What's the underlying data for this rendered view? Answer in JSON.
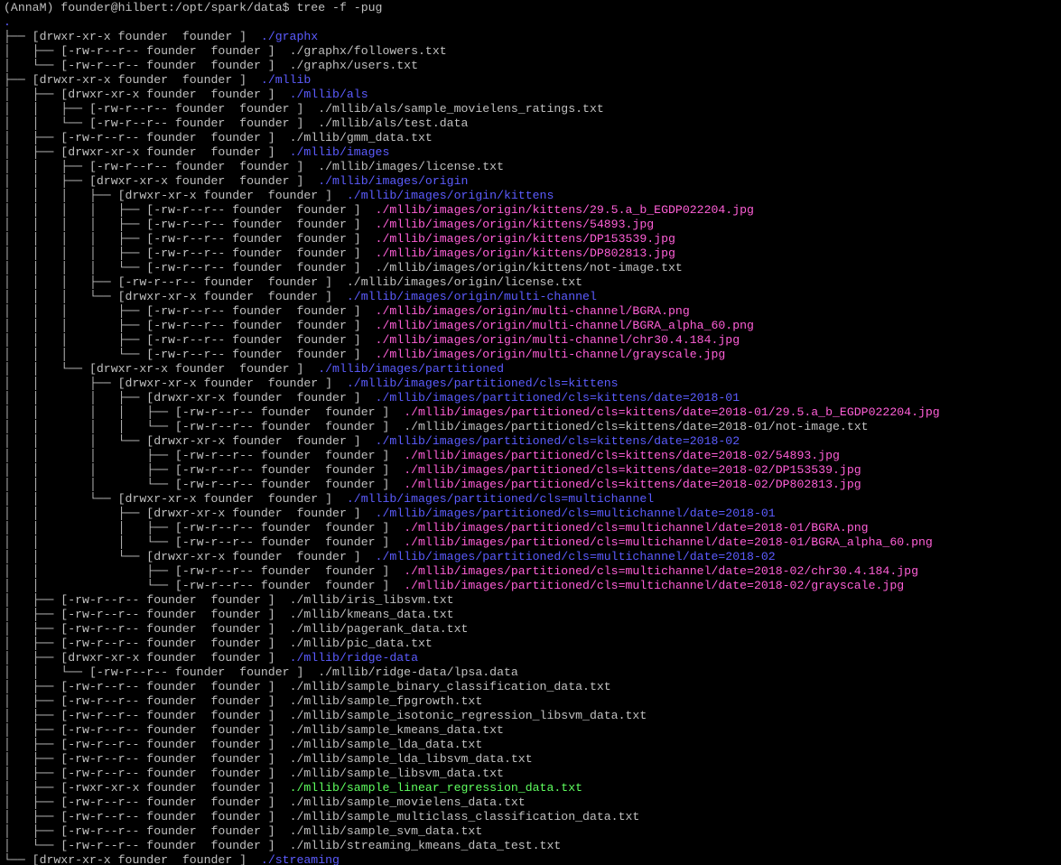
{
  "terminal": {
    "prompt": "(AnnaM) founder@hilbert:/opt/spark/data$ tree -f -pug",
    "colors": {
      "default": "#c0c0c0",
      "dir": "#5c5cff",
      "img": "#ff5fd7",
      "exec": "#5fff5f",
      "background": "#000000"
    },
    "lines": [
      {
        "prefix": ".",
        "path": "",
        "kind": "dir"
      },
      {
        "prefix": "├── [drwxr-xr-x founder  founder ]  ",
        "path": "./graphx",
        "kind": "dir"
      },
      {
        "prefix": "│   ├── [-rw-r--r-- founder  founder ]  ",
        "path": "./graphx/followers.txt",
        "kind": "default"
      },
      {
        "prefix": "│   └── [-rw-r--r-- founder  founder ]  ",
        "path": "./graphx/users.txt",
        "kind": "default"
      },
      {
        "prefix": "├── [drwxr-xr-x founder  founder ]  ",
        "path": "./mllib",
        "kind": "dir"
      },
      {
        "prefix": "│   ├── [drwxr-xr-x founder  founder ]  ",
        "path": "./mllib/als",
        "kind": "dir"
      },
      {
        "prefix": "│   │   ├── [-rw-r--r-- founder  founder ]  ",
        "path": "./mllib/als/sample_movielens_ratings.txt",
        "kind": "default"
      },
      {
        "prefix": "│   │   └── [-rw-r--r-- founder  founder ]  ",
        "path": "./mllib/als/test.data",
        "kind": "default"
      },
      {
        "prefix": "│   ├── [-rw-r--r-- founder  founder ]  ",
        "path": "./mllib/gmm_data.txt",
        "kind": "default"
      },
      {
        "prefix": "│   ├── [drwxr-xr-x founder  founder ]  ",
        "path": "./mllib/images",
        "kind": "dir"
      },
      {
        "prefix": "│   │   ├── [-rw-r--r-- founder  founder ]  ",
        "path": "./mllib/images/license.txt",
        "kind": "default"
      },
      {
        "prefix": "│   │   ├── [drwxr-xr-x founder  founder ]  ",
        "path": "./mllib/images/origin",
        "kind": "dir"
      },
      {
        "prefix": "│   │   │   ├── [drwxr-xr-x founder  founder ]  ",
        "path": "./mllib/images/origin/kittens",
        "kind": "dir"
      },
      {
        "prefix": "│   │   │   │   ├── [-rw-r--r-- founder  founder ]  ",
        "path": "./mllib/images/origin/kittens/29.5.a_b_EGDP022204.jpg",
        "kind": "img"
      },
      {
        "prefix": "│   │   │   │   ├── [-rw-r--r-- founder  founder ]  ",
        "path": "./mllib/images/origin/kittens/54893.jpg",
        "kind": "img"
      },
      {
        "prefix": "│   │   │   │   ├── [-rw-r--r-- founder  founder ]  ",
        "path": "./mllib/images/origin/kittens/DP153539.jpg",
        "kind": "img"
      },
      {
        "prefix": "│   │   │   │   ├── [-rw-r--r-- founder  founder ]  ",
        "path": "./mllib/images/origin/kittens/DP802813.jpg",
        "kind": "img"
      },
      {
        "prefix": "│   │   │   │   └── [-rw-r--r-- founder  founder ]  ",
        "path": "./mllib/images/origin/kittens/not-image.txt",
        "kind": "default"
      },
      {
        "prefix": "│   │   │   ├── [-rw-r--r-- founder  founder ]  ",
        "path": "./mllib/images/origin/license.txt",
        "kind": "default"
      },
      {
        "prefix": "│   │   │   └── [drwxr-xr-x founder  founder ]  ",
        "path": "./mllib/images/origin/multi-channel",
        "kind": "dir"
      },
      {
        "prefix": "│   │   │       ├── [-rw-r--r-- founder  founder ]  ",
        "path": "./mllib/images/origin/multi-channel/BGRA.png",
        "kind": "img"
      },
      {
        "prefix": "│   │   │       ├── [-rw-r--r-- founder  founder ]  ",
        "path": "./mllib/images/origin/multi-channel/BGRA_alpha_60.png",
        "kind": "img"
      },
      {
        "prefix": "│   │   │       ├── [-rw-r--r-- founder  founder ]  ",
        "path": "./mllib/images/origin/multi-channel/chr30.4.184.jpg",
        "kind": "img"
      },
      {
        "prefix": "│   │   │       └── [-rw-r--r-- founder  founder ]  ",
        "path": "./mllib/images/origin/multi-channel/grayscale.jpg",
        "kind": "img"
      },
      {
        "prefix": "│   │   └── [drwxr-xr-x founder  founder ]  ",
        "path": "./mllib/images/partitioned",
        "kind": "dir"
      },
      {
        "prefix": "│   │       ├── [drwxr-xr-x founder  founder ]  ",
        "path": "./mllib/images/partitioned/cls=kittens",
        "kind": "dir"
      },
      {
        "prefix": "│   │       │   ├── [drwxr-xr-x founder  founder ]  ",
        "path": "./mllib/images/partitioned/cls=kittens/date=2018-01",
        "kind": "dir"
      },
      {
        "prefix": "│   │       │   │   ├── [-rw-r--r-- founder  founder ]  ",
        "path": "./mllib/images/partitioned/cls=kittens/date=2018-01/29.5.a_b_EGDP022204.jpg",
        "kind": "img"
      },
      {
        "prefix": "│   │       │   │   └── [-rw-r--r-- founder  founder ]  ",
        "path": "./mllib/images/partitioned/cls=kittens/date=2018-01/not-image.txt",
        "kind": "default"
      },
      {
        "prefix": "│   │       │   └── [drwxr-xr-x founder  founder ]  ",
        "path": "./mllib/images/partitioned/cls=kittens/date=2018-02",
        "kind": "dir"
      },
      {
        "prefix": "│   │       │       ├── [-rw-r--r-- founder  founder ]  ",
        "path": "./mllib/images/partitioned/cls=kittens/date=2018-02/54893.jpg",
        "kind": "img"
      },
      {
        "prefix": "│   │       │       ├── [-rw-r--r-- founder  founder ]  ",
        "path": "./mllib/images/partitioned/cls=kittens/date=2018-02/DP153539.jpg",
        "kind": "img"
      },
      {
        "prefix": "│   │       │       └── [-rw-r--r-- founder  founder ]  ",
        "path": "./mllib/images/partitioned/cls=kittens/date=2018-02/DP802813.jpg",
        "kind": "img"
      },
      {
        "prefix": "│   │       └── [drwxr-xr-x founder  founder ]  ",
        "path": "./mllib/images/partitioned/cls=multichannel",
        "kind": "dir"
      },
      {
        "prefix": "│   │           ├── [drwxr-xr-x founder  founder ]  ",
        "path": "./mllib/images/partitioned/cls=multichannel/date=2018-01",
        "kind": "dir"
      },
      {
        "prefix": "│   │           │   ├── [-rw-r--r-- founder  founder ]  ",
        "path": "./mllib/images/partitioned/cls=multichannel/date=2018-01/BGRA.png",
        "kind": "img"
      },
      {
        "prefix": "│   │           │   └── [-rw-r--r-- founder  founder ]  ",
        "path": "./mllib/images/partitioned/cls=multichannel/date=2018-01/BGRA_alpha_60.png",
        "kind": "img"
      },
      {
        "prefix": "│   │           └── [drwxr-xr-x founder  founder ]  ",
        "path": "./mllib/images/partitioned/cls=multichannel/date=2018-02",
        "kind": "dir"
      },
      {
        "prefix": "│   │               ├── [-rw-r--r-- founder  founder ]  ",
        "path": "./mllib/images/partitioned/cls=multichannel/date=2018-02/chr30.4.184.jpg",
        "kind": "img"
      },
      {
        "prefix": "│   │               └── [-rw-r--r-- founder  founder ]  ",
        "path": "./mllib/images/partitioned/cls=multichannel/date=2018-02/grayscale.jpg",
        "kind": "img"
      },
      {
        "prefix": "│   ├── [-rw-r--r-- founder  founder ]  ",
        "path": "./mllib/iris_libsvm.txt",
        "kind": "default"
      },
      {
        "prefix": "│   ├── [-rw-r--r-- founder  founder ]  ",
        "path": "./mllib/kmeans_data.txt",
        "kind": "default"
      },
      {
        "prefix": "│   ├── [-rw-r--r-- founder  founder ]  ",
        "path": "./mllib/pagerank_data.txt",
        "kind": "default"
      },
      {
        "prefix": "│   ├── [-rw-r--r-- founder  founder ]  ",
        "path": "./mllib/pic_data.txt",
        "kind": "default"
      },
      {
        "prefix": "│   ├── [drwxr-xr-x founder  founder ]  ",
        "path": "./mllib/ridge-data",
        "kind": "dir"
      },
      {
        "prefix": "│   │   └── [-rw-r--r-- founder  founder ]  ",
        "path": "./mllib/ridge-data/lpsa.data",
        "kind": "default"
      },
      {
        "prefix": "│   ├── [-rw-r--r-- founder  founder ]  ",
        "path": "./mllib/sample_binary_classification_data.txt",
        "kind": "default"
      },
      {
        "prefix": "│   ├── [-rw-r--r-- founder  founder ]  ",
        "path": "./mllib/sample_fpgrowth.txt",
        "kind": "default"
      },
      {
        "prefix": "│   ├── [-rw-r--r-- founder  founder ]  ",
        "path": "./mllib/sample_isotonic_regression_libsvm_data.txt",
        "kind": "default"
      },
      {
        "prefix": "│   ├── [-rw-r--r-- founder  founder ]  ",
        "path": "./mllib/sample_kmeans_data.txt",
        "kind": "default"
      },
      {
        "prefix": "│   ├── [-rw-r--r-- founder  founder ]  ",
        "path": "./mllib/sample_lda_data.txt",
        "kind": "default"
      },
      {
        "prefix": "│   ├── [-rw-r--r-- founder  founder ]  ",
        "path": "./mllib/sample_lda_libsvm_data.txt",
        "kind": "default"
      },
      {
        "prefix": "│   ├── [-rw-r--r-- founder  founder ]  ",
        "path": "./mllib/sample_libsvm_data.txt",
        "kind": "default"
      },
      {
        "prefix": "│   ├── [-rwxr-xr-x founder  founder ]  ",
        "path": "./mllib/sample_linear_regression_data.txt",
        "kind": "exec"
      },
      {
        "prefix": "│   ├── [-rw-r--r-- founder  founder ]  ",
        "path": "./mllib/sample_movielens_data.txt",
        "kind": "default"
      },
      {
        "prefix": "│   ├── [-rw-r--r-- founder  founder ]  ",
        "path": "./mllib/sample_multiclass_classification_data.txt",
        "kind": "default"
      },
      {
        "prefix": "│   ├── [-rw-r--r-- founder  founder ]  ",
        "path": "./mllib/sample_svm_data.txt",
        "kind": "default"
      },
      {
        "prefix": "│   └── [-rw-r--r-- founder  founder ]  ",
        "path": "./mllib/streaming_kmeans_data_test.txt",
        "kind": "default"
      },
      {
        "prefix": "└── [drwxr-xr-x founder  founder ]  ",
        "path": "./streaming",
        "kind": "dir"
      }
    ]
  }
}
